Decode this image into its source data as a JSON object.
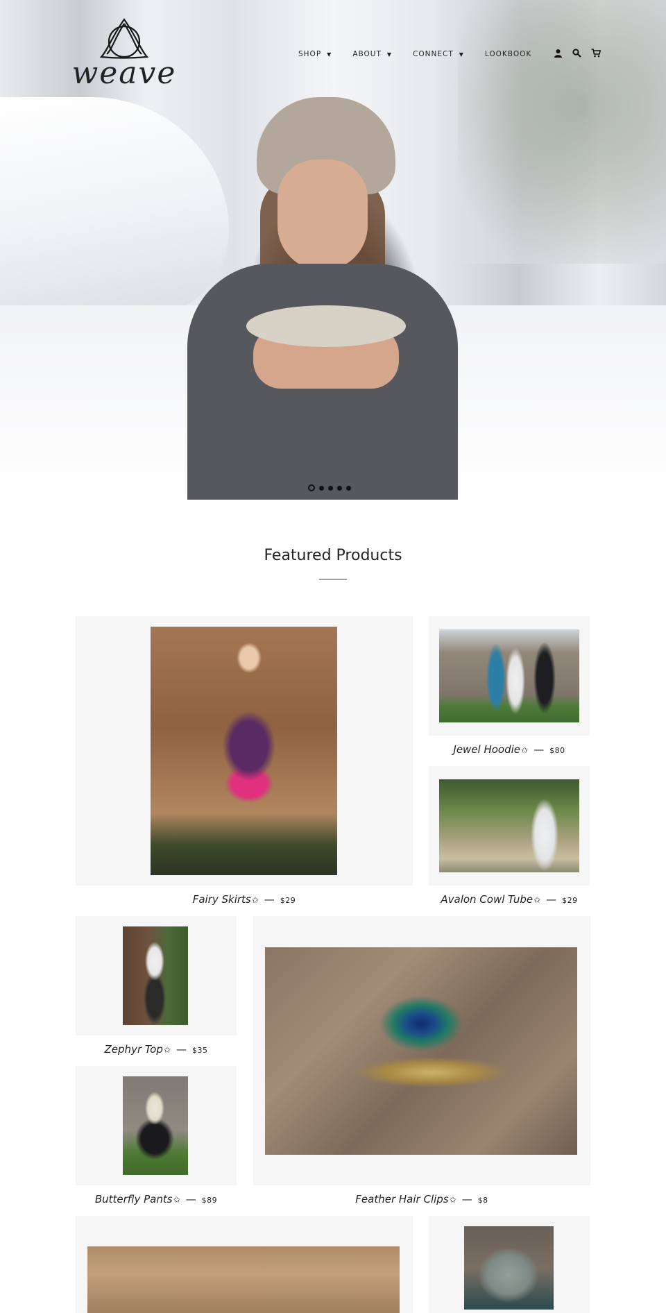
{
  "brand": {
    "name": "weave"
  },
  "nav": {
    "items": [
      {
        "label": "SHOP",
        "has_dropdown": true
      },
      {
        "label": "ABOUT",
        "has_dropdown": true
      },
      {
        "label": "CONNECT",
        "has_dropdown": true
      },
      {
        "label": "LOOKBOOK",
        "has_dropdown": false
      }
    ],
    "icons": [
      "account-icon",
      "search-icon",
      "cart-icon"
    ]
  },
  "hero": {
    "slide_count": 5,
    "active_slide": 1
  },
  "featured": {
    "title": "Featured Products",
    "products": [
      {
        "name": "Fairy Skirts",
        "price": "$29"
      },
      {
        "name": "Jewel Hoodie",
        "price": "$80"
      },
      {
        "name": "Avalon Cowl Tube",
        "price": "$29"
      },
      {
        "name": "Zephyr Top",
        "price": "$35"
      },
      {
        "name": "Butterfly Pants",
        "price": "$89"
      },
      {
        "name": "Feather Hair Clips",
        "price": "$8"
      }
    ],
    "separator": "—",
    "star": "✩"
  },
  "colors": {
    "card_bg": "#f6f6f6",
    "text": "#222222"
  }
}
